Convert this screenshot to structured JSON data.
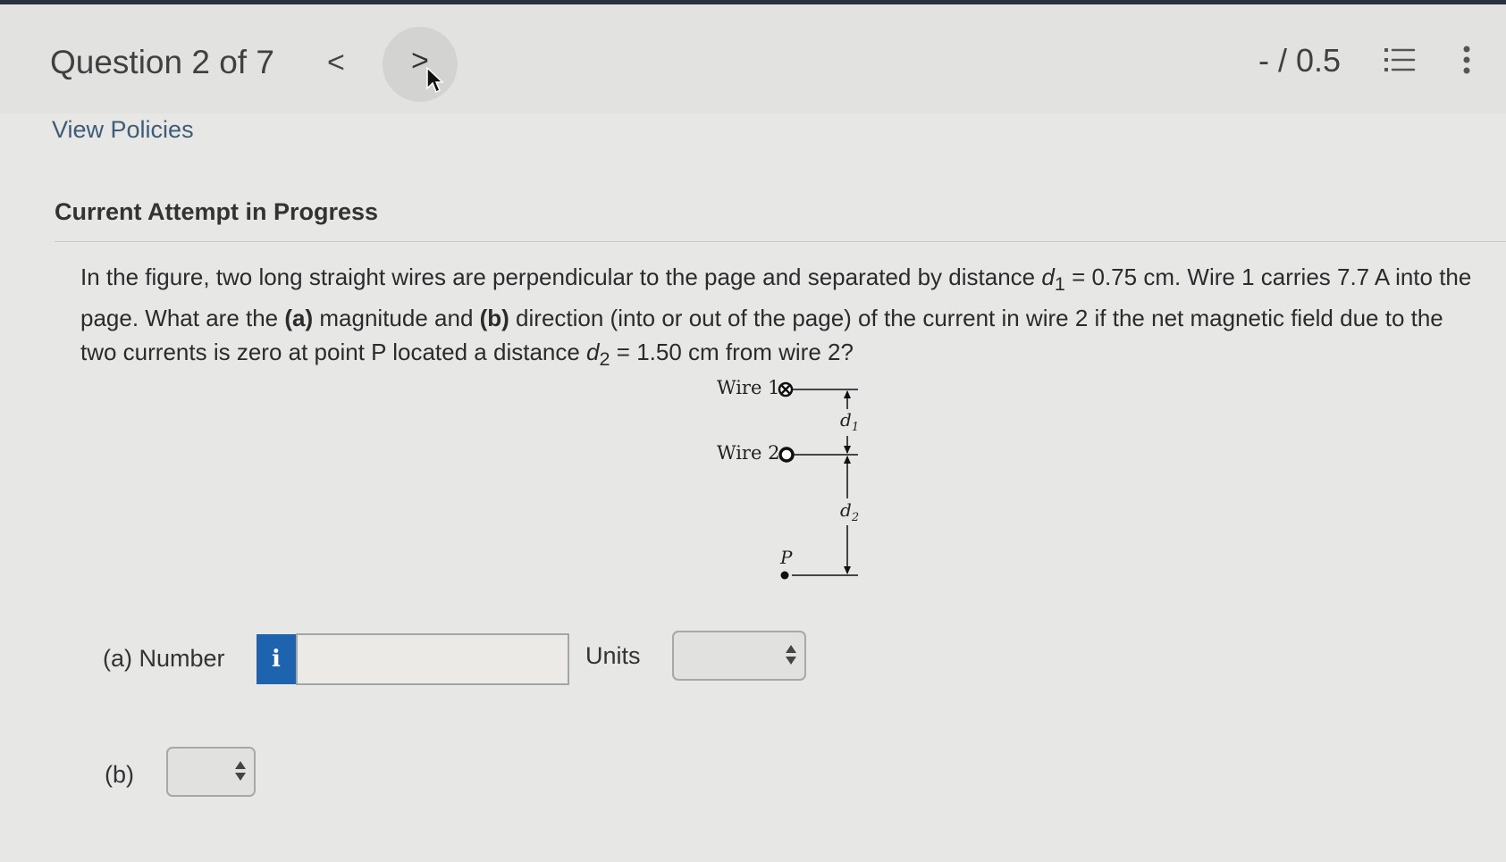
{
  "header": {
    "question_label": "Question 2 of 7",
    "prev_glyph": "<",
    "next_glyph": ">",
    "score": "- / 0.5",
    "list_icon": "list-icon",
    "more_icon": "more-vertical-icon"
  },
  "links": {
    "view_policies": "View Policies"
  },
  "attempt_heading": "Current Attempt in Progress",
  "question": {
    "part1": "In the figure, two long straight wires are perpendicular to the page and separated by distance ",
    "d1_var": "d",
    "d1_sub": "1",
    "part2": " = 0.75 cm. Wire 1 carries 7.7 A into the page. What are the ",
    "a_tag": "(a)",
    "part3": " magnitude and ",
    "b_tag": "(b)",
    "part4": " direction (into or out of the page) of the current in wire 2 if the net magnetic field due to the two currents is zero at point P located a distance ",
    "d2_var": "d",
    "d2_sub": "2",
    "part5": " = 1.50 cm from wire 2?"
  },
  "figure": {
    "wire1": "Wire 1",
    "wire2": "Wire 2",
    "d1_var": "d",
    "d1_sub": "1",
    "d2_var": "d",
    "d2_sub": "2",
    "point": "P"
  },
  "answer": {
    "a_label": "(a) Number",
    "info_glyph": "i",
    "number_value": "",
    "units_label": "Units",
    "units_selected": "",
    "b_label": "(b)",
    "b_selected": ""
  },
  "colors": {
    "accent": "#1e63ad",
    "link": "#3e5c78"
  }
}
